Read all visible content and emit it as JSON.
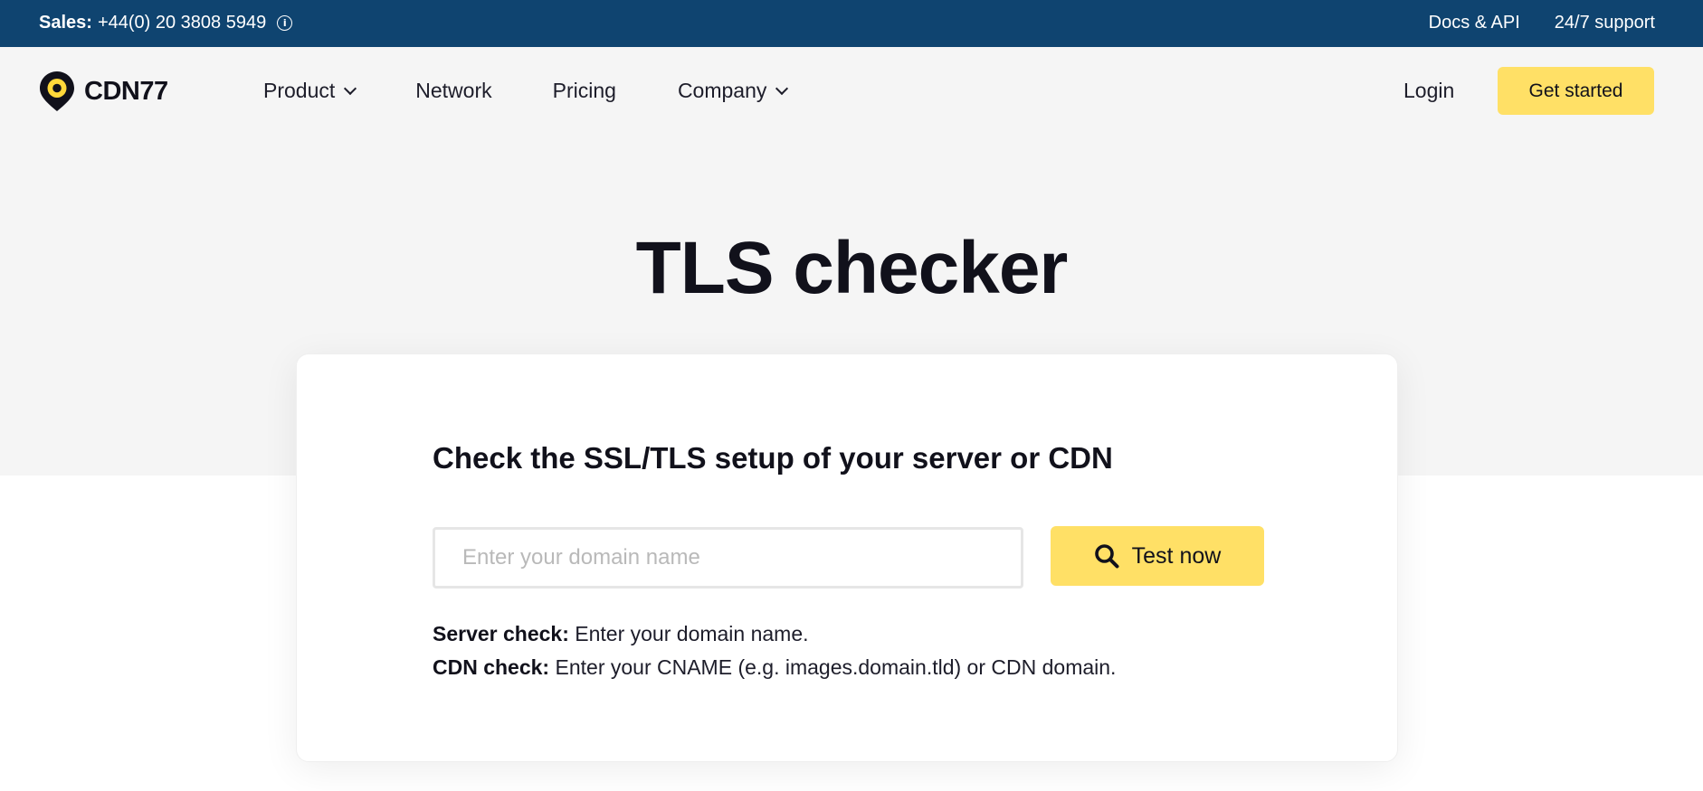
{
  "topbar": {
    "sales_label": "Sales:",
    "sales_phone": "+44(0) 20 3808 5949",
    "info_icon": "info-icon",
    "docs_link": "Docs & API",
    "support_link": "24/7 support",
    "background": "#0f4470"
  },
  "nav": {
    "logo_text": "CDN77",
    "logo_icon": "location-pin-icon",
    "items": [
      {
        "label": "Product",
        "has_dropdown": true
      },
      {
        "label": "Network",
        "has_dropdown": false
      },
      {
        "label": "Pricing",
        "has_dropdown": false
      },
      {
        "label": "Company",
        "has_dropdown": true
      }
    ],
    "login_label": "Login",
    "cta_label": "Get started"
  },
  "hero": {
    "title": "TLS checker"
  },
  "checker": {
    "heading": "Check the SSL/TLS setup of your server or CDN",
    "input_placeholder": "Enter your domain name",
    "input_value": "",
    "button_label": "Test now",
    "button_icon": "search-icon",
    "hints": [
      {
        "label": "Server check:",
        "text": "Enter your domain name."
      },
      {
        "label": "CDN check:",
        "text": "Enter your CNAME (e.g. images.domain.tld) or CDN domain."
      }
    ]
  },
  "colors": {
    "accent_yellow": "#ffe066",
    "text_dark": "#11111b",
    "hero_bg": "#f5f5f5"
  }
}
